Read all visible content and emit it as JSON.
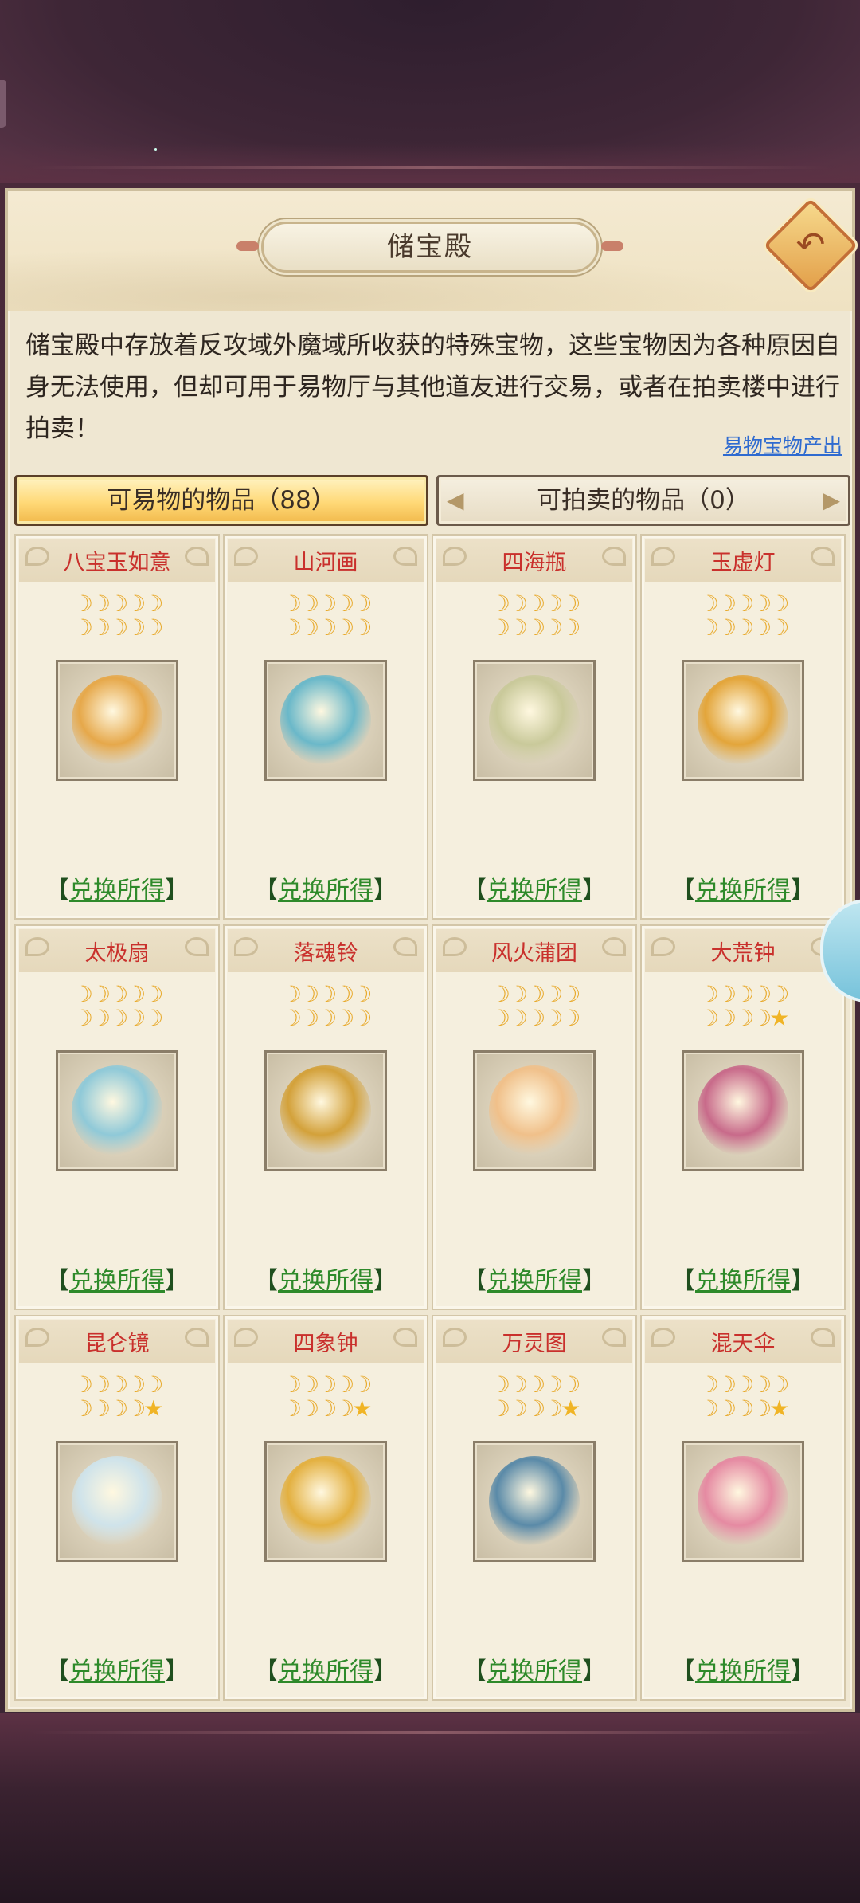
{
  "title": "储宝殿",
  "description": "储宝殿中存放着反攻域外魔域所收获的特殊宝物，这些宝物因为各种原因自身无法使用，但却可用于易物厅与其他道友进行交易，或者在拍卖楼中进行拍卖！",
  "source_link": "易物宝物产出",
  "tabs": {
    "tradable": "可易物的物品（88）",
    "auctionable": "可拍卖的物品（0）"
  },
  "exchange_label": "兑换所得",
  "bracket_left": "【",
  "bracket_right": "】",
  "items": [
    {
      "name": "八宝玉如意",
      "moons": 10,
      "stars": 0,
      "art": "ruyi-icon",
      "color": "#e6a84a"
    },
    {
      "name": "山河画",
      "moons": 10,
      "stars": 0,
      "art": "scroll-painting-icon",
      "color": "#6ab8c9"
    },
    {
      "name": "四海瓶",
      "moons": 10,
      "stars": 0,
      "art": "vase-icon",
      "color": "#c9c99a"
    },
    {
      "name": "玉虚灯",
      "moons": 10,
      "stars": 0,
      "art": "lamp-icon",
      "color": "#e3a53a"
    },
    {
      "name": "太极扇",
      "moons": 10,
      "stars": 0,
      "art": "fan-icon",
      "color": "#8fc9d8"
    },
    {
      "name": "落魂铃",
      "moons": 10,
      "stars": 0,
      "art": "bell-icon",
      "color": "#d3a13a"
    },
    {
      "name": "风火蒲团",
      "moons": 10,
      "stars": 0,
      "art": "cushion-icon",
      "color": "#f0c08a"
    },
    {
      "name": "大荒钟",
      "moons": 9,
      "stars": 1,
      "art": "bell-tower-icon",
      "color": "#c86a8a"
    },
    {
      "name": "昆仑镜",
      "moons": 9,
      "stars": 1,
      "art": "mirror-icon",
      "color": "#cfe3ea"
    },
    {
      "name": "四象钟",
      "moons": 9,
      "stars": 1,
      "art": "golden-bell-icon",
      "color": "#e3b040"
    },
    {
      "name": "万灵图",
      "moons": 9,
      "stars": 1,
      "art": "scroll-icon",
      "color": "#5a8aa8"
    },
    {
      "name": "混天伞",
      "moons": 9,
      "stars": 1,
      "art": "umbrella-icon",
      "color": "#e58aa2"
    }
  ]
}
